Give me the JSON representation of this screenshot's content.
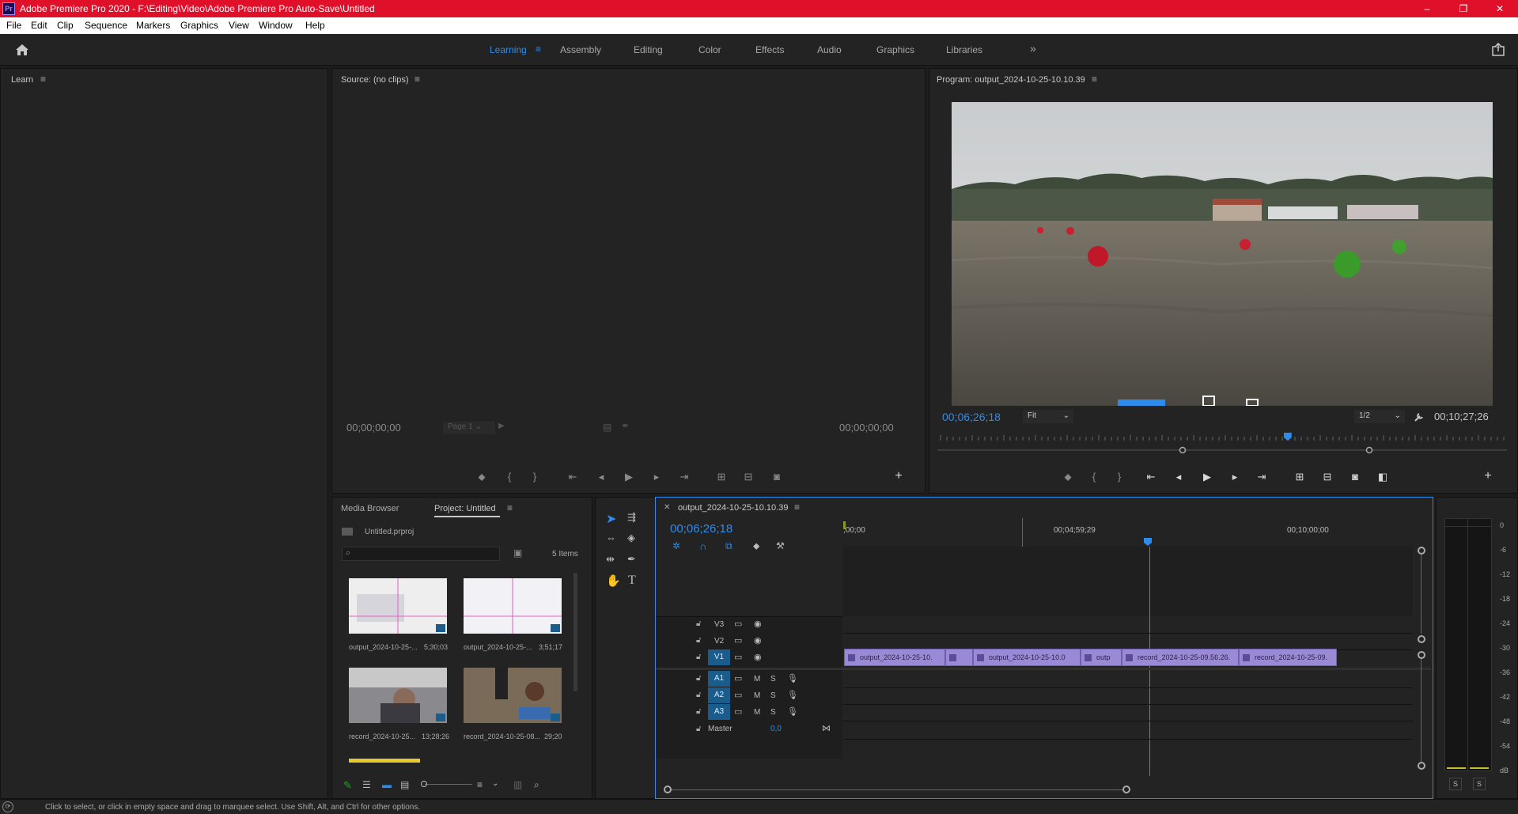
{
  "window": {
    "title": "Adobe Premiere Pro 2020 - F:\\Editing\\Video\\Adobe Premiere Pro Auto-Save\\Untitled",
    "app_icon": "Pr",
    "minimize": "–",
    "maximize": "❐",
    "close": "✕"
  },
  "menu": [
    "File",
    "Edit",
    "Clip",
    "Sequence",
    "Markers",
    "Graphics",
    "View",
    "Window",
    "Help"
  ],
  "workspaces": {
    "tabs": [
      "Learning",
      "Assembly",
      "Editing",
      "Color",
      "Effects",
      "Audio",
      "Graphics",
      "Libraries"
    ],
    "active": "Learning",
    "overflow": "»"
  },
  "learn_panel": {
    "title": "Learn"
  },
  "source_panel": {
    "title": "Source: (no clips)",
    "timecode_in": "00;00;00;00",
    "timecode_out": "00;00;00;00",
    "page": "Page 1"
  },
  "program_panel": {
    "title": "Program: output_2024-10-25-10.10.39",
    "timecode": "00;06;26;18",
    "duration": "00;10;27;26",
    "zoom": "Fit",
    "resolution": "1/2",
    "playhead_fraction": 0.615
  },
  "project_panel": {
    "tabs": [
      "Media Browser",
      "Project: Untitled"
    ],
    "active_tab": "Project: Untitled",
    "project_file": "Untitled.prproj",
    "search_placeholder": "",
    "item_count": "5 Items",
    "items": [
      {
        "name": "output_2024-10-25-...",
        "duration": "5;30;03"
      },
      {
        "name": "output_2024-10-25-...",
        "duration": "3;51;17"
      },
      {
        "name": "record_2024-10-25...",
        "duration": "13;28;26"
      },
      {
        "name": "record_2024-10-25-08...",
        "duration": "29;20"
      }
    ]
  },
  "timeline": {
    "sequence_name": "output_2024-10-25-10.10.39",
    "timecode": "00;06;26;18",
    "ruler": [
      ";00;00",
      "00;04;59;29",
      "00;10;00;00"
    ],
    "video_tracks": [
      "V3",
      "V2",
      "V1"
    ],
    "audio_tracks": [
      "A1",
      "A2",
      "A3"
    ],
    "master_label": "Master",
    "master_value": "0,0",
    "mute": "M",
    "solo": "S",
    "clips": [
      "output_2024-10-25-10.",
      "output_2024-10-25-10.0",
      "outp",
      "record_2024-10-25-09.56.26.",
      "record_2024-10-25-09."
    ]
  },
  "audio_meter": {
    "scale": [
      "0",
      "-6",
      "-12",
      "-18",
      "-24",
      "-30",
      "-36",
      "-42",
      "-48",
      "-54",
      "dB"
    ],
    "solo_left": "S",
    "solo_right": "S"
  },
  "status_bar": {
    "text": "Click to select, or click in empty space and drag to marquee select. Use Shift, Alt, and Ctrl for other options."
  },
  "colors": {
    "title_bar": "#e0102a",
    "accent_blue": "#2d8ceb",
    "clip_purple": "#9a8ad6",
    "panel_bg": "#232323"
  }
}
